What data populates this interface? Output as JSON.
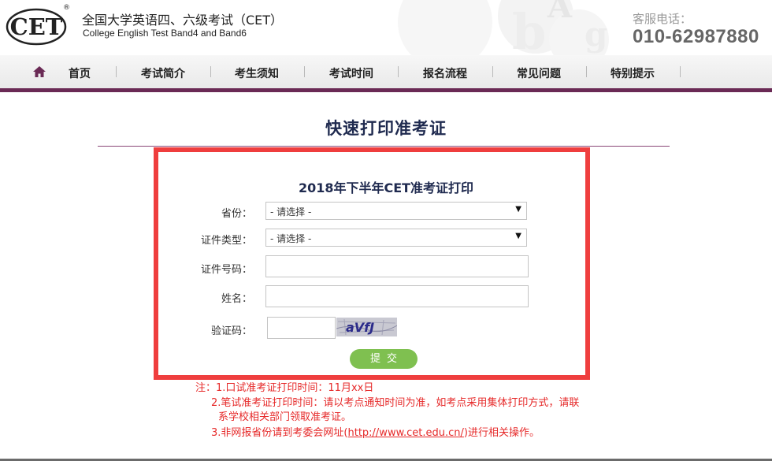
{
  "header": {
    "logo_text": "CET",
    "registered_mark": "®",
    "title": "全国大学英语四、六级考试（CET）",
    "subtitle": "College English Test Band4 and Band6",
    "hotline_label": "客服电话：",
    "hotline_number": "010-62987880",
    "deco_letters": [
      "A",
      "b",
      "g"
    ]
  },
  "nav": {
    "items": [
      {
        "label": "首页"
      },
      {
        "label": "考试简介"
      },
      {
        "label": "考生须知"
      },
      {
        "label": "考试时间"
      },
      {
        "label": "报名流程"
      },
      {
        "label": "常见问题"
      },
      {
        "label": "特别提示"
      }
    ]
  },
  "page": {
    "title": "快速打印准考证"
  },
  "form": {
    "title": "2018年下半年CET准考证打印",
    "province_label": "省份：",
    "province_value": "- 请选择 -",
    "id_type_label": "证件类型：",
    "id_type_value": "- 请选择 -",
    "id_number_label": "证件号码：",
    "name_label": "姓名：",
    "captcha_label": "验证码：",
    "captcha_text": "aVfJ",
    "submit_label": "提交"
  },
  "notes": {
    "line1": "注：1.口试准考证打印时间：11月xx日",
    "line2": "2.笔试准考证打印时间：请以考点通知时间为准，如考点采用集体打印方式，请联",
    "line3": "系学校相关部门领取准考证。",
    "line4_prefix": "3.非网报省份请到考委会网址(",
    "line4_link": "http://www.cet.edu.cn/",
    "line4_suffix": ")进行相关操作。"
  },
  "colors": {
    "nav_underline": "#6a2a55",
    "title_text": "#1f2a4f",
    "highlight_border": "#ef3e3e",
    "submit_button": "#7fc050",
    "note_text": "#e62a2a"
  }
}
